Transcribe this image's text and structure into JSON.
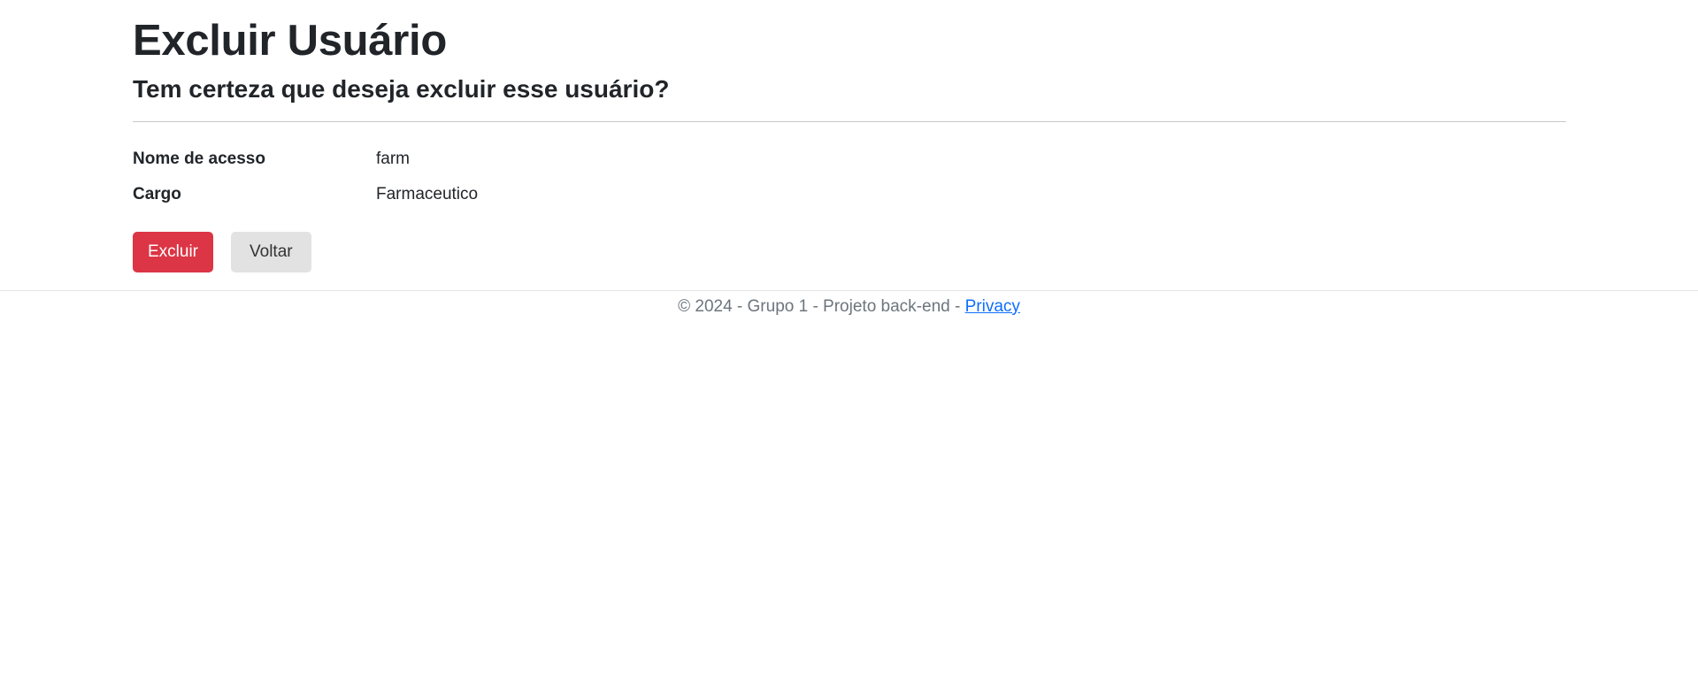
{
  "page": {
    "title": "Excluir Usuário",
    "subtitle": "Tem certeza que deseja excluir esse usuário?"
  },
  "details": [
    {
      "label": "Nome de acesso",
      "value": "farm"
    },
    {
      "label": "Cargo",
      "value": "Farmaceutico"
    }
  ],
  "actions": {
    "delete_label": "Excluir",
    "back_label": "Voltar"
  },
  "footer": {
    "text": "© 2024 - Grupo 1 - Projeto back-end - ",
    "privacy_label": "Privacy"
  },
  "colors": {
    "danger": "#dc3545",
    "link": "#0d6efd",
    "muted": "#6c757d"
  }
}
